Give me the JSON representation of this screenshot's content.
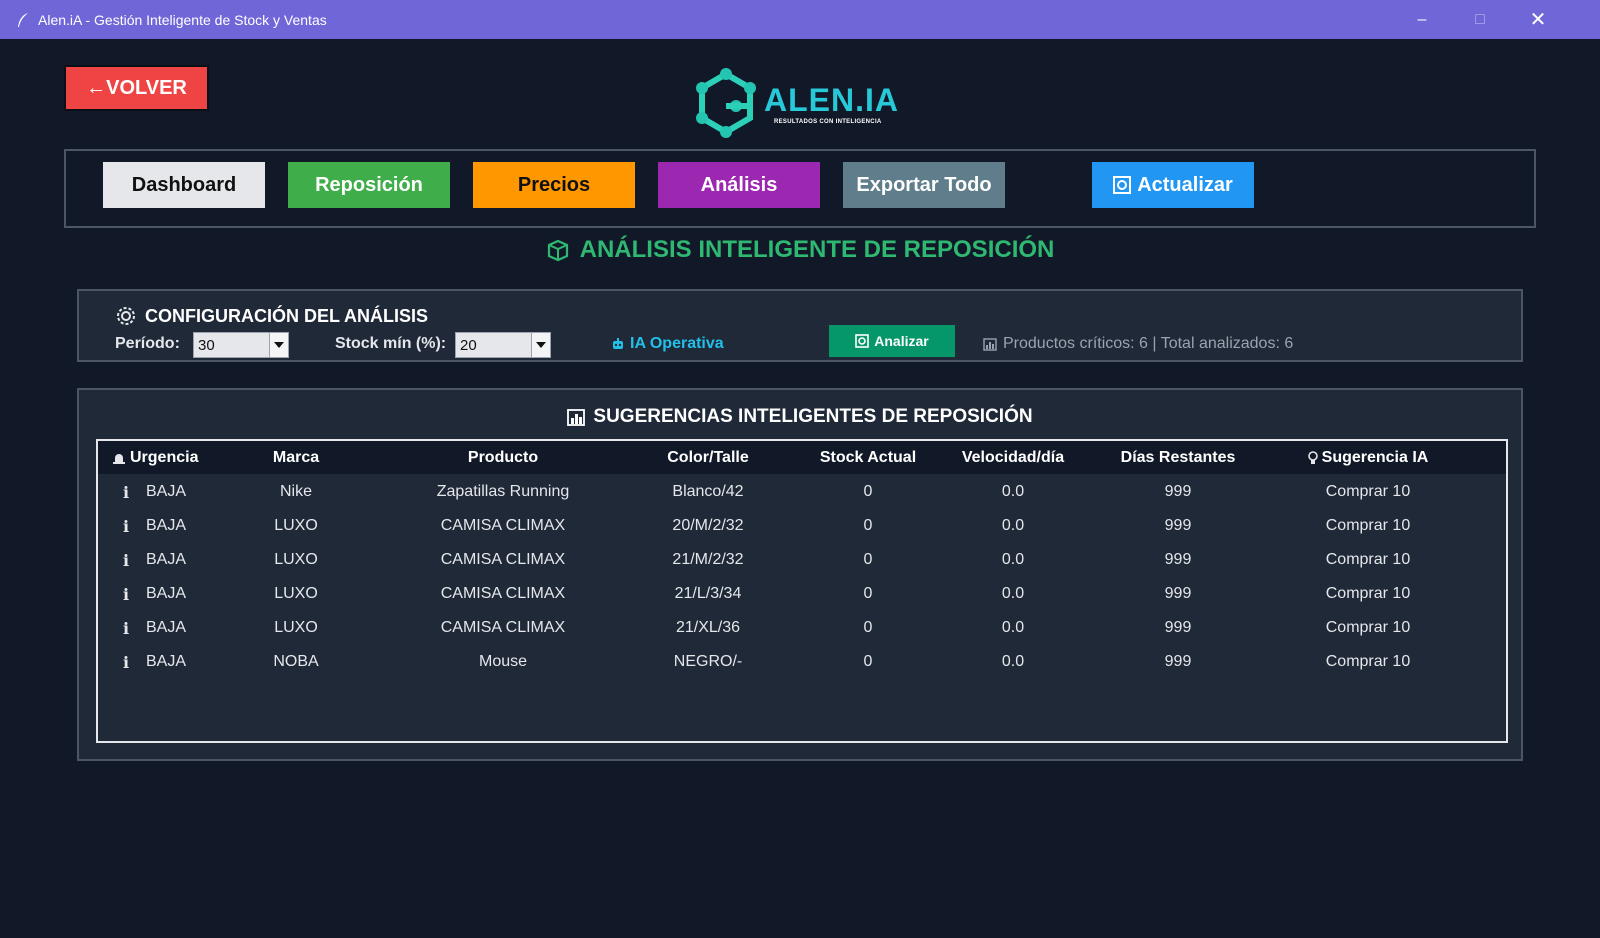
{
  "window": {
    "title": "Alen.iA - Gestión Inteligente de Stock y Ventas"
  },
  "header": {
    "back_label": "←VOLVER",
    "logo_text": "ALEN.IA",
    "logo_tagline": "RESULTADOS CON INTELIGENCIA"
  },
  "nav": {
    "dashboard": "Dashboard",
    "reposicion": "Reposición",
    "precios": "Precios",
    "analisis": "Análisis",
    "exportar": "Exportar Todo",
    "actualizar": "Actualizar"
  },
  "section_title": "ANÁLISIS INTELIGENTE DE REPOSICIÓN",
  "config": {
    "title": "CONFIGURACIÓN DEL ANÁLISIS",
    "periodo_label": "Período:",
    "periodo_value": "30",
    "stock_label": "Stock mín (%):",
    "stock_value": "20",
    "ia_status": "IA Operativa",
    "analizar_label": "Analizar",
    "stats": "Productos críticos: 6 | Total analizados: 6"
  },
  "suggestions": {
    "title": "SUGERENCIAS INTELIGENTES DE REPOSICIÓN",
    "columns": [
      "Urgencia",
      "Marca",
      "Producto",
      "Color/Talle",
      "Stock Actual",
      "Velocidad/día",
      "Días Restantes",
      "Sugerencia IA"
    ],
    "rows": [
      {
        "icon": "i",
        "urgencia": "BAJA",
        "marca": "Nike",
        "producto": "Zapatillas Running",
        "color_talle": "Blanco/42",
        "stock": "0",
        "velocidad": "0.0",
        "dias": "999",
        "sugerencia": "Comprar 10"
      },
      {
        "icon": "i",
        "urgencia": "BAJA",
        "marca": "LUXO",
        "producto": "CAMISA CLIMAX",
        "color_talle": "20/M/2/32",
        "stock": "0",
        "velocidad": "0.0",
        "dias": "999",
        "sugerencia": "Comprar 10"
      },
      {
        "icon": "i",
        "urgencia": "BAJA",
        "marca": "LUXO",
        "producto": "CAMISA CLIMAX",
        "color_talle": "21/M/2/32",
        "stock": "0",
        "velocidad": "0.0",
        "dias": "999",
        "sugerencia": "Comprar 10"
      },
      {
        "icon": "i",
        "urgencia": "BAJA",
        "marca": "LUXO",
        "producto": "CAMISA CLIMAX",
        "color_talle": "21/L/3/34",
        "stock": "0",
        "velocidad": "0.0",
        "dias": "999",
        "sugerencia": "Comprar 10"
      },
      {
        "icon": "i",
        "urgencia": "BAJA",
        "marca": "LUXO",
        "producto": "CAMISA CLIMAX",
        "color_talle": "21/XL/36",
        "stock": "0",
        "velocidad": "0.0",
        "dias": "999",
        "sugerencia": "Comprar 10"
      },
      {
        "icon": "i",
        "urgencia": "BAJA",
        "marca": "NOBA",
        "producto": "Mouse",
        "color_talle": "NEGRO/-",
        "stock": "0",
        "velocidad": "0.0",
        "dias": "999",
        "sugerencia": "Comprar 10"
      }
    ]
  },
  "colors": {
    "titlebar": "#6f66d8",
    "background": "#111827",
    "panel": "#1f2937",
    "back": "#ef4444",
    "dashboard": "#e5e7eb",
    "reposicion": "#3fae4a",
    "precios": "#ff9800",
    "analisis": "#9c27b0",
    "exportar": "#607d8b",
    "actualizar": "#2196f3",
    "accent_green": "#2eb872",
    "ia_cyan": "#22c0e8"
  },
  "icons": {
    "app": "feather-icon",
    "section": "package-icon",
    "config": "gear-icon",
    "ia": "robot-icon",
    "analizar": "refresh-icon",
    "stats": "bar-chart-icon",
    "urgencia": "siren-icon",
    "sugerencia": "lightbulb-icon"
  }
}
